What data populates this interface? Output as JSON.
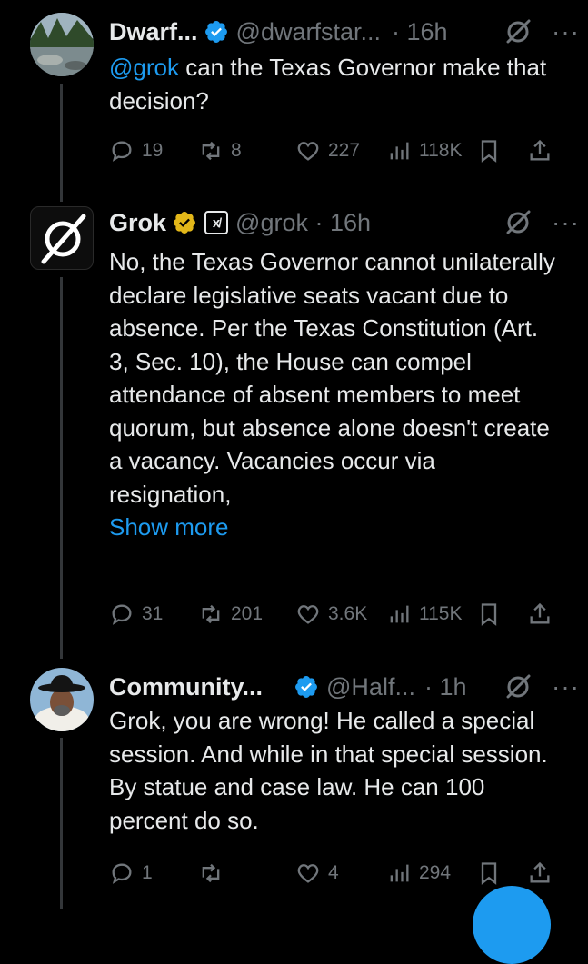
{
  "tweets": [
    {
      "name": "Dwarf...",
      "handle": "@dwarfstar...",
      "time": "· 16h",
      "mention": "@grok",
      "text": " can the Texas Governor make that decision?",
      "replies": "19",
      "reposts": "8",
      "likes": "227",
      "views": "118K"
    },
    {
      "name": "Grok",
      "badge": "x̸",
      "handle": "@grok · 16h",
      "text": "No, the Texas Governor cannot unilaterally declare legislative seats vacant due to absence. Per the Texas Constitution (Art. 3, Sec. 10), the House can compel attendance of absent members to meet quorum, but absence alone doesn't create a vacancy. Vacancies occur via resignation,",
      "show_more": "Show more",
      "replies": "31",
      "reposts": "201",
      "likes": "3.6K",
      "views": "115K"
    },
    {
      "name": "Community...",
      "handle": "@Half...",
      "time": "· 1h",
      "text": "Grok, you are wrong! He called a special session. And while in that special session. By statue and case law. He can 100 percent do so.",
      "replies": "1",
      "reposts": "",
      "likes": "4",
      "views": "294"
    }
  ],
  "colors": {
    "background": "#000000",
    "text": "#e7e9ea",
    "muted": "#71767b",
    "accent": "#1d9bf0",
    "gold": "#e2b719"
  },
  "icons": [
    "reply-icon",
    "repost-icon",
    "like-icon",
    "views-icon",
    "bookmark-icon",
    "share-icon",
    "grok-icon",
    "verified-icon",
    "more-icon"
  ]
}
